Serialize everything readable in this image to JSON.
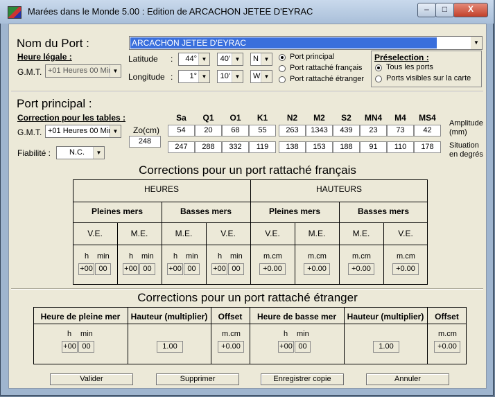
{
  "window": {
    "title": "Marées dans le Monde 5.00 : Edition de ARCACHON JETEE D'EYRAC",
    "minimize": "–",
    "maximize": "□",
    "close": "X",
    "icon": "app-icon"
  },
  "port": {
    "label": "Nom du Port :",
    "value": "ARCACHON JETEE D'EYRAC"
  },
  "legal_time": {
    "label": "Heure légale :",
    "gmt_label": "G.M.T.",
    "gmt_value": "+01 Heures 00 Min"
  },
  "position": {
    "lat_label": "Latitude",
    "lon_label": "Longitude",
    "colon": ":",
    "lat_deg": "44°",
    "lat_min": "40'",
    "lat_hemi": "N",
    "lon_deg": "1°",
    "lon_min": "10'",
    "lon_hemi": "W"
  },
  "port_type": {
    "options": [
      "Port principal",
      "Port rattaché français",
      "Port rattaché étranger"
    ],
    "selected": 0
  },
  "preselection": {
    "title": "Préselection :",
    "options": [
      "Tous les ports",
      "Ports visibles sur la carte"
    ],
    "selected": 0
  },
  "principal": {
    "title": "Port principal :",
    "correction_label": "Correction pour les tables :",
    "gmt_label": "G.M.T.",
    "gmt_value": "+01 Heures 00 Min",
    "fiabilite_label": "Fiabilité :",
    "fiabilite_value": "N.C.",
    "zo_label": "Zo(cm)",
    "zo_value": "248",
    "constituents": [
      "Sa",
      "Q1",
      "O1",
      "K1",
      "N2",
      "M2",
      "S2",
      "MN4",
      "M4",
      "MS4"
    ],
    "amplitude": [
      "54",
      "20",
      "68",
      "55",
      "263",
      "1343",
      "439",
      "23",
      "73",
      "42"
    ],
    "phase": [
      "247",
      "288",
      "332",
      "119",
      "138",
      "153",
      "188",
      "91",
      "110",
      "178"
    ],
    "amplitude_label_1": "Amplitude",
    "amplitude_label_2": "(mm)",
    "phase_label_1": "Situation",
    "phase_label_2": "en degrés"
  },
  "fr": {
    "title": "Corrections pour un port rattaché français",
    "heures": "HEURES",
    "hauteurs": "HAUTEURS",
    "pleines": "Pleines mers",
    "basses": "Basses mers",
    "cols": [
      "V.E.",
      "M.E.",
      "M.E.",
      "V.E.",
      "V.E.",
      "M.E.",
      "M.E.",
      "V.E."
    ],
    "h": "h",
    "min": "min",
    "mcm": "m.cm",
    "hval": "+00",
    "mval": "00",
    "cmval": "+0.00"
  },
  "etr": {
    "title": "Corrections pour un port rattaché étranger",
    "h_pleine": "Heure de pleine mer",
    "hauteur_mult": "Hauteur (multiplier)",
    "offset": "Offset",
    "h_basse": "Heure de basse mer",
    "h": "h",
    "min": "min",
    "mcm": "m.cm",
    "hval": "+00",
    "mval": "00",
    "mult_val": "1.00",
    "off_val": "+0.00"
  },
  "buttons": {
    "valider": "Valider",
    "supprimer": "Supprimer",
    "enregistrer": "Enregistrer copie",
    "annuler": "Annuler"
  },
  "colors": {
    "accent": "#3a6fdc",
    "face": "#ece9d8"
  }
}
